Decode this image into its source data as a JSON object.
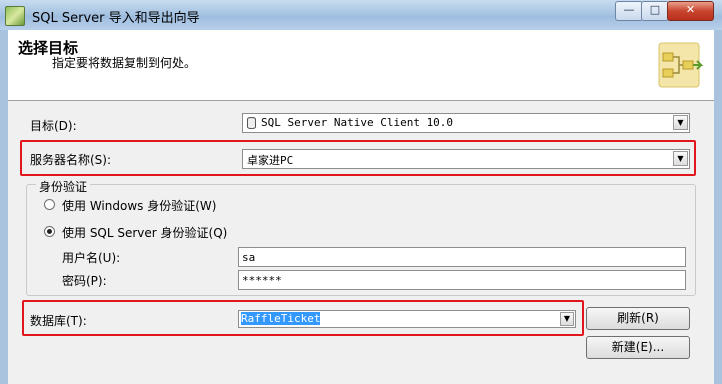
{
  "window": {
    "title": "SQL Server 导入和导出向导",
    "min_label": "—",
    "max_label": "□",
    "close_label": "✕"
  },
  "header": {
    "title": "选择目标",
    "subtitle": "指定要将数据复制到何处。"
  },
  "destination": {
    "label": "目标(D):",
    "value": "SQL Server Native Client 10.0"
  },
  "server": {
    "label": "服务器名称(S):",
    "value": "卓家进PC"
  },
  "auth": {
    "group_title": "身份验证",
    "windows_option": "使用 Windows 身份验证(W)",
    "sql_option": "使用 SQL Server 身份验证(Q)",
    "selected": "sql",
    "username_label": "用户名(U):",
    "username_value": "sa",
    "password_label": "密码(P):",
    "password_value": "******"
  },
  "database": {
    "label": "数据库(T):",
    "value": "RaffleTicket"
  },
  "buttons": {
    "refresh": "刷新(R)",
    "new": "新建(E)..."
  },
  "colors": {
    "highlight": "#e2161d",
    "selection": "#3399ff"
  }
}
